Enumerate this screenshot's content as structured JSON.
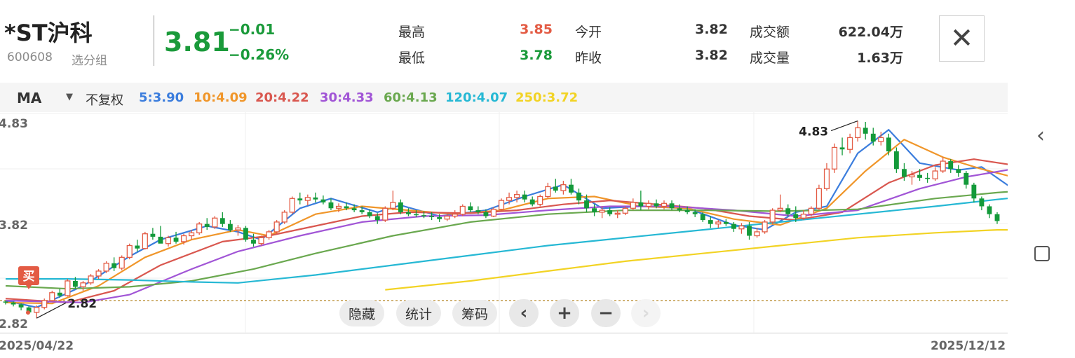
{
  "header": {
    "name": "*ST沪科",
    "code": "600608",
    "watch_group": "选分组",
    "price": "3.81",
    "change": "−0.01",
    "change_pct": "−0.26%",
    "close_icon": "close-icon"
  },
  "quote": {
    "high_label": "最高",
    "high": "3.85",
    "low_label": "最低",
    "low": "3.78",
    "open_label": "今开",
    "open": "3.82",
    "prev_label": "昨收",
    "prev": "3.82",
    "amount_label": "成交额",
    "amount": "622.04万",
    "volume_label": "成交量",
    "volume": "1.63万"
  },
  "indicator": {
    "type": "MA",
    "adjust": "不复权",
    "ma": [
      {
        "label": "5:3.90",
        "color": "#3b7ddd"
      },
      {
        "label": "10:4.09",
        "color": "#f0962a"
      },
      {
        "label": "20:4.22",
        "color": "#d9574f"
      },
      {
        "label": "30:4.33",
        "color": "#a155d6"
      },
      {
        "label": "60:4.13",
        "color": "#6aa84f"
      },
      {
        "label": "120:4.07",
        "color": "#26b8d4"
      },
      {
        "label": "250:3.72",
        "color": "#f2d324"
      }
    ]
  },
  "colors": {
    "up": "#e35b44",
    "down": "#139a3a",
    "up_text": "#e35b44",
    "down_text": "#1a9a3a"
  },
  "controls": {
    "hide": "隐藏",
    "stats": "统计",
    "chips": "筹码",
    "left_icon": "chevron-left-icon",
    "zoom_in_icon": "plus-icon",
    "zoom_out_icon": "minus-icon",
    "right_icon": "chevron-right-icon"
  },
  "rail": {
    "back_icon": "chevron-left-icon",
    "square_icon": "square-icon"
  },
  "chart_data": {
    "type": "candlestick",
    "x_start": "2025/04/22",
    "x_end": "2025/12/12",
    "y_labels": [
      "4.83",
      "3.82",
      "2.82"
    ],
    "ylim": [
      2.65,
      4.92
    ],
    "max_marker": "4.83",
    "min_marker": "2.82",
    "buy_marker": "买",
    "reference_level": 3.0,
    "grid": true,
    "candles": [
      [
        2.99,
        3.0,
        2.96,
        2.98
      ],
      [
        2.98,
        2.99,
        2.94,
        2.96
      ],
      [
        2.96,
        2.97,
        2.9,
        2.93
      ],
      [
        2.93,
        2.94,
        2.86,
        2.88
      ],
      [
        2.88,
        2.95,
        2.82,
        2.93
      ],
      [
        2.93,
        3.02,
        2.91,
        3.0
      ],
      [
        3.0,
        3.1,
        2.99,
        3.08
      ],
      [
        3.08,
        3.12,
        3.03,
        3.05
      ],
      [
        3.05,
        3.22,
        3.04,
        3.2
      ],
      [
        3.2,
        3.24,
        3.12,
        3.14
      ],
      [
        3.14,
        3.2,
        3.1,
        3.18
      ],
      [
        3.18,
        3.27,
        3.16,
        3.25
      ],
      [
        3.25,
        3.32,
        3.22,
        3.3
      ],
      [
        3.3,
        3.4,
        3.28,
        3.38
      ],
      [
        3.38,
        3.44,
        3.3,
        3.33
      ],
      [
        3.33,
        3.46,
        3.31,
        3.44
      ],
      [
        3.44,
        3.58,
        3.42,
        3.56
      ],
      [
        3.56,
        3.62,
        3.5,
        3.53
      ],
      [
        3.53,
        3.7,
        3.52,
        3.68
      ],
      [
        3.68,
        3.74,
        3.62,
        3.65
      ],
      [
        3.65,
        3.76,
        3.61,
        3.58
      ],
      [
        3.58,
        3.66,
        3.55,
        3.64
      ],
      [
        3.64,
        3.7,
        3.58,
        3.6
      ],
      [
        3.6,
        3.68,
        3.57,
        3.66
      ],
      [
        3.66,
        3.72,
        3.62,
        3.69
      ],
      [
        3.69,
        3.8,
        3.67,
        3.78
      ],
      [
        3.78,
        3.84,
        3.72,
        3.75
      ],
      [
        3.75,
        3.86,
        3.73,
        3.84
      ],
      [
        3.84,
        3.9,
        3.75,
        3.78
      ],
      [
        3.78,
        3.82,
        3.7,
        3.72
      ],
      [
        3.72,
        3.77,
        3.66,
        3.74
      ],
      [
        3.74,
        3.76,
        3.6,
        3.62
      ],
      [
        3.62,
        3.68,
        3.55,
        3.58
      ],
      [
        3.58,
        3.66,
        3.56,
        3.64
      ],
      [
        3.64,
        3.72,
        3.62,
        3.7
      ],
      [
        3.7,
        3.82,
        3.68,
        3.8
      ],
      [
        3.8,
        3.92,
        3.78,
        3.9
      ],
      [
        3.9,
        4.06,
        3.88,
        4.04
      ],
      [
        4.04,
        4.1,
        3.98,
        4.02
      ],
      [
        4.02,
        4.08,
        3.97,
        4.05
      ],
      [
        4.05,
        4.1,
        4.0,
        4.03
      ],
      [
        4.03,
        4.07,
        3.98,
        4.0
      ],
      [
        4.0,
        4.04,
        3.92,
        3.94
      ],
      [
        3.94,
        3.99,
        3.9,
        3.96
      ],
      [
        3.96,
        4.0,
        3.92,
        3.94
      ],
      [
        3.94,
        3.98,
        3.9,
        3.92
      ],
      [
        3.92,
        3.96,
        3.88,
        3.9
      ],
      [
        3.9,
        3.93,
        3.84,
        3.86
      ],
      [
        3.86,
        3.89,
        3.78,
        3.82
      ],
      [
        3.82,
        3.96,
        3.8,
        3.94
      ],
      [
        3.94,
        4.12,
        3.92,
        4.0
      ],
      [
        4.0,
        4.03,
        3.88,
        3.9
      ],
      [
        3.9,
        3.94,
        3.86,
        3.88
      ],
      [
        3.88,
        3.92,
        3.85,
        3.87
      ],
      [
        3.87,
        3.91,
        3.84,
        3.86
      ],
      [
        3.86,
        3.9,
        3.82,
        3.85
      ],
      [
        3.85,
        3.88,
        3.8,
        3.83
      ],
      [
        3.83,
        3.89,
        3.81,
        3.86
      ],
      [
        3.86,
        3.92,
        3.84,
        3.88
      ],
      [
        3.88,
        3.98,
        3.86,
        3.96
      ],
      [
        3.96,
        4.0,
        3.9,
        3.92
      ],
      [
        3.92,
        3.96,
        3.88,
        3.9
      ],
      [
        3.9,
        3.93,
        3.84,
        3.86
      ],
      [
        3.86,
        3.95,
        3.85,
        3.93
      ],
      [
        3.93,
        4.04,
        3.91,
        4.02
      ],
      [
        4.02,
        4.1,
        3.98,
        4.05
      ],
      [
        4.05,
        4.12,
        4.0,
        4.08
      ],
      [
        4.08,
        4.12,
        4.0,
        4.03
      ],
      [
        4.03,
        4.06,
        3.96,
        3.98
      ],
      [
        3.98,
        4.08,
        3.96,
        4.06
      ],
      [
        4.06,
        4.2,
        4.04,
        4.16
      ],
      [
        4.16,
        4.24,
        4.1,
        4.12
      ],
      [
        4.12,
        4.22,
        4.08,
        4.18
      ],
      [
        4.18,
        4.24,
        4.08,
        4.1
      ],
      [
        4.1,
        4.14,
        3.98,
        4.02
      ],
      [
        4.02,
        4.08,
        3.9,
        3.94
      ],
      [
        3.94,
        3.98,
        3.86,
        3.9
      ],
      [
        3.9,
        3.96,
        3.84,
        3.92
      ],
      [
        3.92,
        3.95,
        3.86,
        3.88
      ],
      [
        3.88,
        3.92,
        3.84,
        3.89
      ],
      [
        3.89,
        3.96,
        3.87,
        3.94
      ],
      [
        3.94,
        4.04,
        3.92,
        4.0
      ],
      [
        4.0,
        4.12,
        3.92,
        3.96
      ],
      [
        3.96,
        4.02,
        3.93,
        3.99
      ],
      [
        3.99,
        4.03,
        3.94,
        3.96
      ],
      [
        3.96,
        4.02,
        3.93,
        3.99
      ],
      [
        3.99,
        4.02,
        3.92,
        3.94
      ],
      [
        3.94,
        3.98,
        3.9,
        3.92
      ],
      [
        3.92,
        3.96,
        3.88,
        3.9
      ],
      [
        3.9,
        3.93,
        3.85,
        3.88
      ],
      [
        3.88,
        3.9,
        3.8,
        3.82
      ],
      [
        3.82,
        3.86,
        3.74,
        3.78
      ],
      [
        3.78,
        3.82,
        3.74,
        3.8
      ],
      [
        3.8,
        3.83,
        3.76,
        3.78
      ],
      [
        3.78,
        3.8,
        3.7,
        3.73
      ],
      [
        3.73,
        3.79,
        3.68,
        3.76
      ],
      [
        3.76,
        3.8,
        3.62,
        3.66
      ],
      [
        3.66,
        3.74,
        3.64,
        3.7
      ],
      [
        3.7,
        3.82,
        3.68,
        3.8
      ],
      [
        3.8,
        3.94,
        3.78,
        3.92
      ],
      [
        3.92,
        4.08,
        3.9,
        3.94
      ],
      [
        3.94,
        3.98,
        3.86,
        3.88
      ],
      [
        3.88,
        3.96,
        3.8,
        3.84
      ],
      [
        3.84,
        3.92,
        3.82,
        3.88
      ],
      [
        3.88,
        3.96,
        3.86,
        3.94
      ],
      [
        3.94,
        4.18,
        3.92,
        4.14
      ],
      [
        4.14,
        4.4,
        4.12,
        4.34
      ],
      [
        4.34,
        4.6,
        4.3,
        4.56
      ],
      [
        4.56,
        4.66,
        4.48,
        4.54
      ],
      [
        4.54,
        4.7,
        4.5,
        4.66
      ],
      [
        4.66,
        4.83,
        4.62,
        4.76
      ],
      [
        4.76,
        4.82,
        4.64,
        4.7
      ],
      [
        4.7,
        4.76,
        4.58,
        4.62
      ],
      [
        4.62,
        4.72,
        4.58,
        4.66
      ],
      [
        4.66,
        4.7,
        4.48,
        4.52
      ],
      [
        4.52,
        4.56,
        4.3,
        4.34
      ],
      [
        4.34,
        4.4,
        4.22,
        4.26
      ],
      [
        4.26,
        4.32,
        4.18,
        4.28
      ],
      [
        4.28,
        4.34,
        4.22,
        4.25
      ],
      [
        4.25,
        4.3,
        4.2,
        4.24
      ],
      [
        4.24,
        4.36,
        4.22,
        4.32
      ],
      [
        4.32,
        4.46,
        4.3,
        4.42
      ],
      [
        4.42,
        4.44,
        4.3,
        4.34
      ],
      [
        4.34,
        4.38,
        4.26,
        4.3
      ],
      [
        4.3,
        4.32,
        4.14,
        4.18
      ],
      [
        4.18,
        4.2,
        4.0,
        4.04
      ],
      [
        4.04,
        4.06,
        3.92,
        3.96
      ],
      [
        3.96,
        3.98,
        3.84,
        3.88
      ],
      [
        3.88,
        3.9,
        3.78,
        3.81
      ]
    ],
    "ma_series": [
      {
        "name": "5",
        "color": "#3b7ddd",
        "points": [
          [
            0,
            3.0
          ],
          [
            4,
            2.93
          ],
          [
            10,
            3.15
          ],
          [
            16,
            3.45
          ],
          [
            20,
            3.62
          ],
          [
            26,
            3.76
          ],
          [
            30,
            3.7
          ],
          [
            33,
            3.62
          ],
          [
            38,
            3.94
          ],
          [
            42,
            4.04
          ],
          [
            48,
            3.9
          ],
          [
            51,
            3.97
          ],
          [
            56,
            3.86
          ],
          [
            62,
            3.92
          ],
          [
            67,
            4.06
          ],
          [
            72,
            4.18
          ],
          [
            77,
            3.94
          ],
          [
            82,
            3.96
          ],
          [
            88,
            3.94
          ],
          [
            94,
            3.77
          ],
          [
            98,
            3.72
          ],
          [
            102,
            3.9
          ],
          [
            106,
            3.96
          ],
          [
            110,
            4.5
          ],
          [
            114,
            4.74
          ],
          [
            118,
            4.4
          ],
          [
            123,
            4.33
          ],
          [
            126,
            4.36
          ],
          [
            130,
            4.14
          ],
          [
            133,
            3.9
          ]
        ]
      },
      {
        "name": "10",
        "color": "#f0962a",
        "points": [
          [
            0,
            2.98
          ],
          [
            6,
            2.97
          ],
          [
            12,
            3.15
          ],
          [
            18,
            3.44
          ],
          [
            24,
            3.62
          ],
          [
            30,
            3.72
          ],
          [
            34,
            3.66
          ],
          [
            40,
            3.88
          ],
          [
            46,
            3.96
          ],
          [
            52,
            3.92
          ],
          [
            58,
            3.88
          ],
          [
            64,
            3.92
          ],
          [
            70,
            4.04
          ],
          [
            76,
            4.06
          ],
          [
            82,
            3.96
          ],
          [
            88,
            3.94
          ],
          [
            94,
            3.83
          ],
          [
            100,
            3.77
          ],
          [
            106,
            3.94
          ],
          [
            111,
            4.32
          ],
          [
            116,
            4.64
          ],
          [
            121,
            4.46
          ],
          [
            126,
            4.34
          ],
          [
            130,
            4.26
          ],
          [
            133,
            4.09
          ]
        ]
      },
      {
        "name": "20",
        "color": "#d9574f",
        "points": [
          [
            0,
            3.02
          ],
          [
            8,
            2.98
          ],
          [
            14,
            3.1
          ],
          [
            20,
            3.36
          ],
          [
            28,
            3.6
          ],
          [
            34,
            3.66
          ],
          [
            40,
            3.76
          ],
          [
            46,
            3.86
          ],
          [
            52,
            3.9
          ],
          [
            60,
            3.89
          ],
          [
            66,
            3.92
          ],
          [
            72,
            3.98
          ],
          [
            78,
            4.02
          ],
          [
            84,
            3.98
          ],
          [
            90,
            3.94
          ],
          [
            96,
            3.86
          ],
          [
            102,
            3.82
          ],
          [
            108,
            3.9
          ],
          [
            114,
            4.2
          ],
          [
            120,
            4.38
          ],
          [
            125,
            4.44
          ],
          [
            130,
            4.38
          ],
          [
            133,
            4.22
          ]
        ]
      },
      {
        "name": "30",
        "color": "#a155d6",
        "points": [
          [
            0,
            3.0
          ],
          [
            10,
            2.98
          ],
          [
            16,
            3.06
          ],
          [
            24,
            3.32
          ],
          [
            30,
            3.5
          ],
          [
            38,
            3.66
          ],
          [
            46,
            3.8
          ],
          [
            54,
            3.86
          ],
          [
            62,
            3.87
          ],
          [
            70,
            3.92
          ],
          [
            78,
            3.96
          ],
          [
            86,
            3.96
          ],
          [
            94,
            3.92
          ],
          [
            102,
            3.86
          ],
          [
            110,
            3.92
          ],
          [
            118,
            4.14
          ],
          [
            124,
            4.26
          ],
          [
            130,
            4.34
          ],
          [
            133,
            4.33
          ]
        ]
      },
      {
        "name": "60",
        "color": "#6aa84f",
        "points": [
          [
            0,
            3.15
          ],
          [
            8,
            3.12
          ],
          [
            16,
            3.14
          ],
          [
            24,
            3.2
          ],
          [
            32,
            3.32
          ],
          [
            40,
            3.48
          ],
          [
            50,
            3.66
          ],
          [
            60,
            3.8
          ],
          [
            70,
            3.88
          ],
          [
            80,
            3.92
          ],
          [
            90,
            3.92
          ],
          [
            100,
            3.91
          ],
          [
            110,
            3.93
          ],
          [
            120,
            4.04
          ],
          [
            128,
            4.1
          ],
          [
            133,
            4.13
          ]
        ]
      },
      {
        "name": "120",
        "color": "#26b8d4",
        "points": [
          [
            0,
            3.22
          ],
          [
            8,
            3.22
          ],
          [
            16,
            3.21
          ],
          [
            24,
            3.19
          ],
          [
            30,
            3.18
          ],
          [
            40,
            3.26
          ],
          [
            50,
            3.36
          ],
          [
            60,
            3.46
          ],
          [
            70,
            3.56
          ],
          [
            80,
            3.64
          ],
          [
            90,
            3.72
          ],
          [
            100,
            3.8
          ],
          [
            110,
            3.88
          ],
          [
            120,
            3.96
          ],
          [
            128,
            4.03
          ],
          [
            133,
            4.07
          ]
        ]
      },
      {
        "name": "250",
        "color": "#f2d324",
        "points": [
          [
            49,
            3.11
          ],
          [
            60,
            3.2
          ],
          [
            70,
            3.3
          ],
          [
            80,
            3.4
          ],
          [
            90,
            3.48
          ],
          [
            100,
            3.56
          ],
          [
            110,
            3.64
          ],
          [
            120,
            3.69
          ],
          [
            128,
            3.72
          ],
          [
            133,
            3.72
          ]
        ]
      }
    ]
  }
}
